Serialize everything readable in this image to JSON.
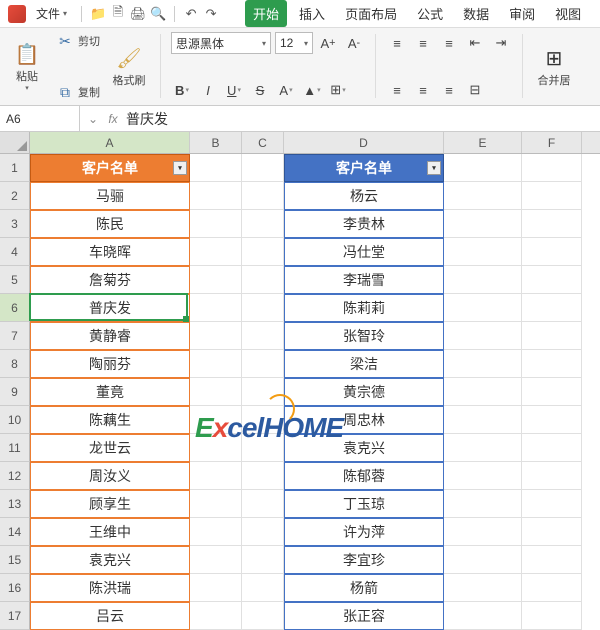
{
  "menubar": {
    "file_label": "文件",
    "tabs": [
      "开始",
      "插入",
      "页面布局",
      "公式",
      "数据",
      "审阅",
      "视图"
    ]
  },
  "ribbon": {
    "paste": "粘贴",
    "cut": "剪切",
    "copy": "复制",
    "format_painter": "格式刷",
    "merge": "合并居",
    "font_name": "思源黑体",
    "font_size": "12"
  },
  "namebox": "A6",
  "formula": "普庆发",
  "columns": [
    "A",
    "B",
    "C",
    "D",
    "E",
    "F"
  ],
  "rows": [
    "1",
    "2",
    "3",
    "4",
    "5",
    "6",
    "7",
    "8",
    "9",
    "10",
    "11",
    "12",
    "13",
    "14",
    "15",
    "16",
    "17"
  ],
  "headerA": "客户名单",
  "headerD": "客户名单",
  "dataA": [
    "马骊",
    "陈民",
    "车晓晖",
    "詹菊芬",
    "普庆发",
    "黄静睿",
    "陶丽芬",
    "董竟",
    "陈藕生",
    "龙世云",
    "周汝义",
    "顾享生",
    "王维中",
    "袁克兴",
    "陈洪瑞",
    "吕云"
  ],
  "dataD": [
    "杨云",
    "李贵林",
    "冯仕堂",
    "李瑞雪",
    "陈莉莉",
    "张智玲",
    "梁洁",
    "黄宗德",
    "周忠林",
    "袁克兴",
    "陈郁蓉",
    "丁玉琼",
    "许为萍",
    "李宜珍",
    "杨箭",
    "张正容"
  ],
  "selected_cell": "A6",
  "watermark": {
    "text1": "E",
    "text2": "x",
    "text3": "celHOME"
  }
}
